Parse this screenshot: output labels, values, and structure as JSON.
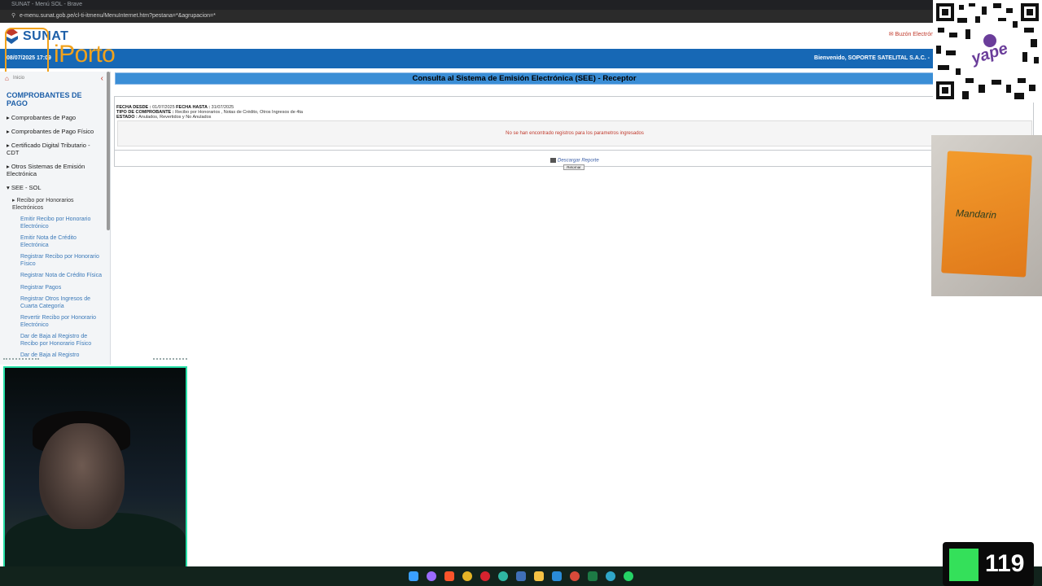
{
  "browser": {
    "title": "SUNAT - Menú SOL - Brave",
    "url": "e-menu.sunat.gob.pe/cl-ti-itmenu/MenuInternet.htm?pestana=*&agrupacion=*"
  },
  "header": {
    "logo_text": "SUNAT",
    "buzon_label": "Buzón Electrón",
    "date": "08/07/2025 17:09",
    "welcome": "Bienvenido, SOPORTE SATELITAL S.A.C. -",
    "overlay_brand": "iPorto"
  },
  "sidebar": {
    "home_label": "Inicio",
    "section_title": "COMPROBANTES DE PAGO",
    "items": [
      "Comprobantes de Pago",
      "Comprobantes de Pago Físico",
      "Certificado Digital Tributario - CDT",
      "Otros Sistemas de Emisión Electrónica",
      "SEE - SOL"
    ],
    "subitem": "Recibo por Honorarios Electrónicos",
    "links": [
      "Emitir Recibo por Honorario Electrónico",
      "Emitir Nota de Crédito Electrónica",
      "Registrar Recibo por Honorario Físico",
      "Registrar Nota de Crédito Física",
      "Registrar Pagos",
      "Registrar Otros Ingresos de Cuarta Categoría",
      "Revertir Recibo por Honorario Electrónico",
      "Dar de Baja al Registro de Recibo por Honorario Físico",
      "Dar de Baja al Registro"
    ]
  },
  "main": {
    "title": "Consulta al Sistema de Emisión Electrónica (SEE) - Receptor",
    "fecha_desde_label": "FECHA DESDE :",
    "fecha_desde": "01/07/2025",
    "fecha_hasta_label": "FECHA HASTA :",
    "fecha_hasta": "31/07/2025",
    "tipo_label": "TIPO DE COMPROBANTE :",
    "tipo_value": "Recibo por Honorarios , Notas de Crédito, Otros Ingresos de 4ta",
    "estado_label": "ESTADO :",
    "estado_value": "Anulados, Revertidos y No Anulados",
    "no_results": "No se han encontrado registros para los parametros ingresados",
    "download_label": "Descargar Reporte",
    "back_label": "Retornar"
  },
  "overlays": {
    "qr_brand": "yape",
    "product_text": "Mandarin",
    "counter_value": "119"
  },
  "colors": {
    "sunat_blue": "#1768b5",
    "title_blue": "#3b8ed6",
    "error_red": "#c0392b",
    "link_blue": "#3b79b8"
  }
}
